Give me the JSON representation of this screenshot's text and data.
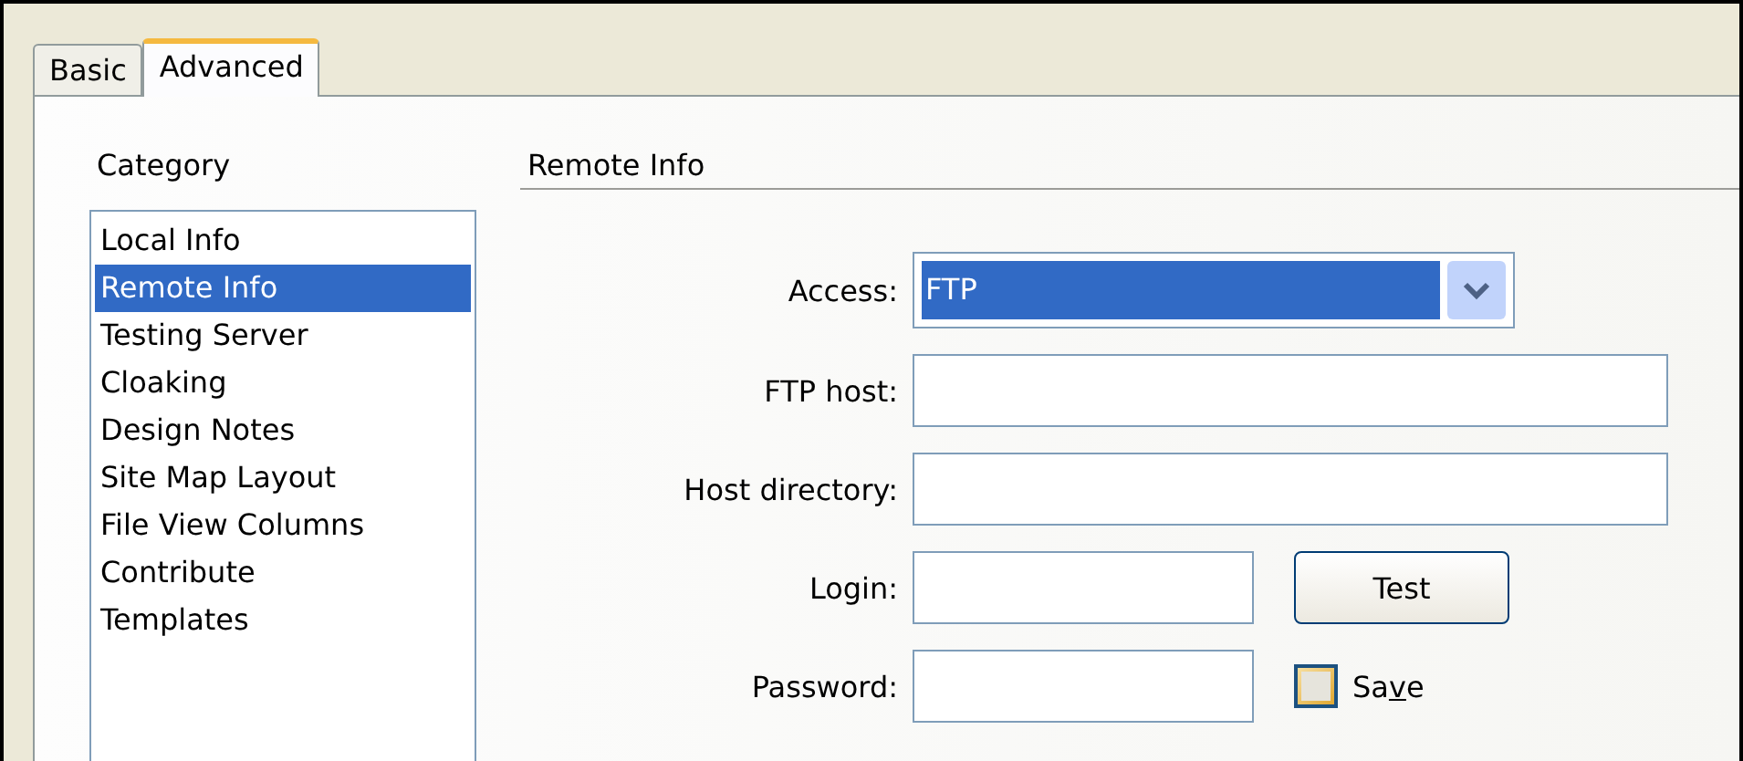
{
  "tabs": [
    {
      "label": "Basic",
      "selected": false
    },
    {
      "label": "Advanced",
      "selected": true
    }
  ],
  "category": {
    "title": "Category",
    "items": [
      {
        "label": "Local Info",
        "selected": false
      },
      {
        "label": "Remote Info",
        "selected": true
      },
      {
        "label": "Testing Server",
        "selected": false
      },
      {
        "label": "Cloaking",
        "selected": false
      },
      {
        "label": "Design Notes",
        "selected": false
      },
      {
        "label": "Site Map Layout",
        "selected": false
      },
      {
        "label": "File View Columns",
        "selected": false
      },
      {
        "label": "Contribute",
        "selected": false
      },
      {
        "label": "Templates",
        "selected": false
      }
    ]
  },
  "section": {
    "title": "Remote Info"
  },
  "form": [
    {
      "kind": "select",
      "label": "Access:",
      "value": "FTP"
    },
    {
      "kind": "text",
      "label": "FTP host:"
    },
    {
      "kind": "text",
      "label": "Host directory:"
    },
    {
      "kind": "text-button",
      "label": "Login:",
      "button": "Test"
    },
    {
      "kind": "text-check",
      "label": "Password:",
      "check": {
        "label_before": "Sa",
        "mnemonic": "v",
        "label_after": "e",
        "checked": false
      }
    }
  ]
}
